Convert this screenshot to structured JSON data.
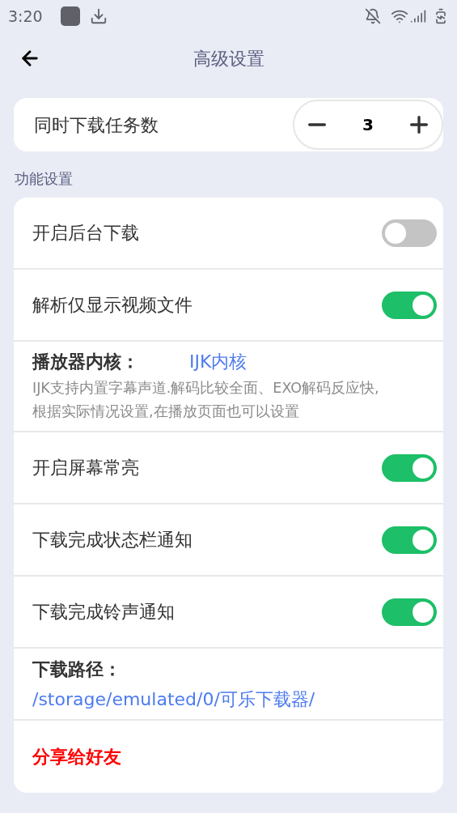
{
  "status_bar": {
    "time": "3:20"
  },
  "header": {
    "title": "高级设置"
  },
  "concurrent": {
    "label": "同时下载任务数",
    "value": "3"
  },
  "section_title": "功能设置",
  "rows": [
    {
      "kind": "toggle",
      "label": "开启后台下载",
      "on": false
    },
    {
      "kind": "toggle",
      "label": "解析仅显示视频文件",
      "on": true
    },
    {
      "kind": "player",
      "label": "播放器内核：",
      "value": "IJK内核",
      "description": "IJK支持内置字幕声道.解码比较全面、EXO解码反应快,根据实际情况设置,在播放页面也可以设置"
    },
    {
      "kind": "toggle",
      "label": "开启屏幕常亮",
      "on": true
    },
    {
      "kind": "toggle",
      "label": "下载完成状态栏通知",
      "on": true
    },
    {
      "kind": "toggle",
      "label": "下载完成铃声通知",
      "on": true
    },
    {
      "kind": "path",
      "label": "下载路径：",
      "value": "/storage/emulated/0/可乐下载器/"
    },
    {
      "kind": "link",
      "label": "分享给好友"
    }
  ]
}
